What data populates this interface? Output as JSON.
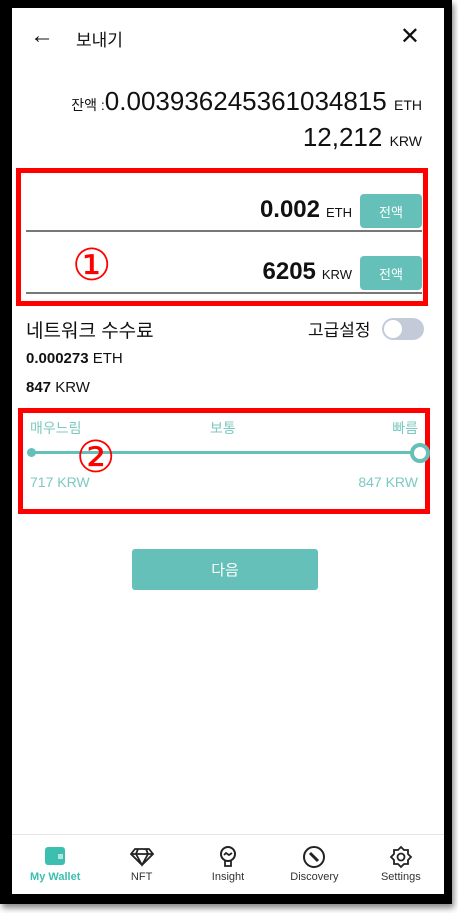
{
  "header": {
    "title": "보내기",
    "back_icon": "arrow-left-icon",
    "close_icon": "close-icon"
  },
  "balance": {
    "label": "잔액 :",
    "eth_value": "0.003936245361034815",
    "eth_unit": "ETH",
    "krw_value": "12,212",
    "krw_unit": "KRW"
  },
  "amount": {
    "eth_value": "0.002",
    "eth_unit": "ETH",
    "krw_value": "6205",
    "krw_unit": "KRW",
    "max_label": "전액"
  },
  "fee": {
    "title": "네트워크 수수료",
    "advanced_label": "고급설정",
    "advanced_on": false,
    "eth_value": "0.000273",
    "eth_unit": "ETH",
    "krw_value": "847",
    "krw_unit": "KRW"
  },
  "speed": {
    "slow": "매우느림",
    "normal": "보통",
    "fast": "빠름",
    "min": "717 KRW",
    "max": "847 KRW",
    "level": 1.0
  },
  "annotations": {
    "one": "①",
    "two": "②",
    "color": "#ff0000"
  },
  "next_label": "다음",
  "accent": "#64c0b8",
  "tabs": [
    {
      "label": "My Wallet",
      "icon": "wallet-icon"
    },
    {
      "label": "NFT",
      "icon": "diamond-icon"
    },
    {
      "label": "Insight",
      "icon": "lightbulb-icon"
    },
    {
      "label": "Discovery",
      "icon": "compass-icon"
    },
    {
      "label": "Settings",
      "icon": "gear-icon"
    }
  ]
}
